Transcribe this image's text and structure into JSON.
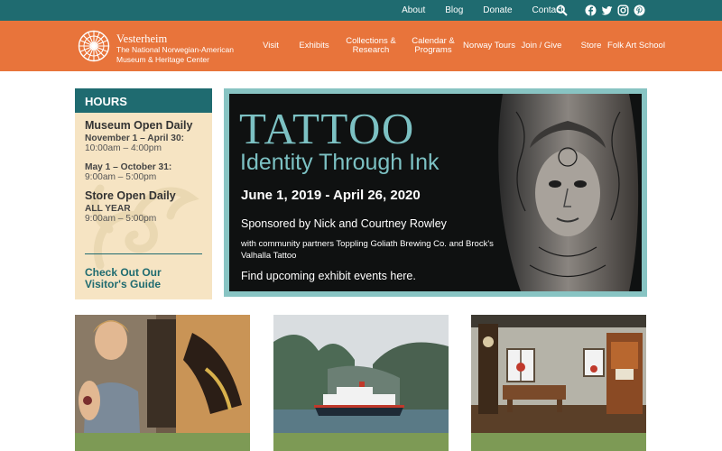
{
  "topbar": {
    "links": [
      "About",
      "Blog",
      "Donate",
      "Contact"
    ],
    "search_icon": "search-icon",
    "social_icons": [
      "facebook-icon",
      "twitter-icon",
      "instagram-icon",
      "pinterest-icon"
    ]
  },
  "brand": {
    "name": "Vesterheim",
    "subtitle": "The National Norwegian-American Museum & Heritage Center"
  },
  "nav": [
    "Visit",
    "Exhibits",
    "Collections & Research",
    "Calendar & Programs",
    "Norway Tours",
    "Join / Give",
    "Store",
    "Folk Art School"
  ],
  "hours": {
    "heading": "HOURS",
    "museum_title": "Museum Open Daily",
    "period1_label": "November 1 – April 30:",
    "period1_time": "10:00am – 4:00pm",
    "period2_label": "May 1 – October 31:",
    "period2_time": "9:00am – 5:00pm",
    "store_title": "Store Open Daily",
    "store_label": "ALL YEAR",
    "store_time": "9:00am – 5:00pm",
    "guide_link": "Check Out Our Visitor's Guide"
  },
  "banner": {
    "title": "TATTOO",
    "subtitle": "Identity Through Ink",
    "dates": "June 1, 2019 - April 26, 2020",
    "sponsor": "Sponsored by Nick and Courtney Rowley",
    "partners": "with community partners Toppling Goliath Brewing Co. and Brock's Valhalla Tattoo",
    "cta": "Find upcoming exhibit events here."
  },
  "colors": {
    "teal": "#1f6b70",
    "orange": "#e8743b",
    "cream": "#f6e4c3",
    "banner_accent": "#7cc1c3",
    "card_footer": "#7d9a55"
  }
}
